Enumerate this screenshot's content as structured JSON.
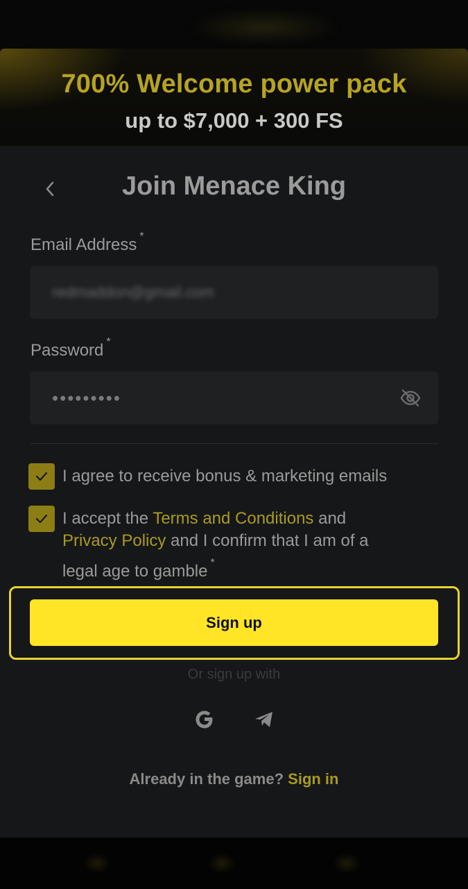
{
  "banner": {
    "title": "700% Welcome power pack",
    "subtitle": "up to $7,000 + 300 FS"
  },
  "form": {
    "title": "Join Menace King",
    "email": {
      "label": "Email Address",
      "required_mark": "*",
      "value": "redmaddon@gmail.com"
    },
    "password": {
      "label": "Password",
      "required_mark": "*",
      "value": "•••••••••"
    },
    "checkbox_marketing": {
      "checked": true,
      "text": "I agree to receive bonus & marketing emails"
    },
    "checkbox_terms": {
      "checked": true,
      "text_1": "I accept the ",
      "link_terms": "Terms and Conditions",
      "text_2": " and",
      "link_privacy": "Privacy Policy",
      "text_3": " and I confirm that I am of a",
      "text_4": "legal age to gamble",
      "required_mark": "*"
    },
    "signup_label": "Sign up",
    "or_text": "Or sign up with",
    "social": [
      "google-icon",
      "telegram-icon"
    ],
    "footer_text": "Already in the game?",
    "footer_link": "Sign in"
  },
  "colors": {
    "accent": "#ffe526",
    "link": "#a99a22",
    "banner_title": "#b6a321"
  }
}
